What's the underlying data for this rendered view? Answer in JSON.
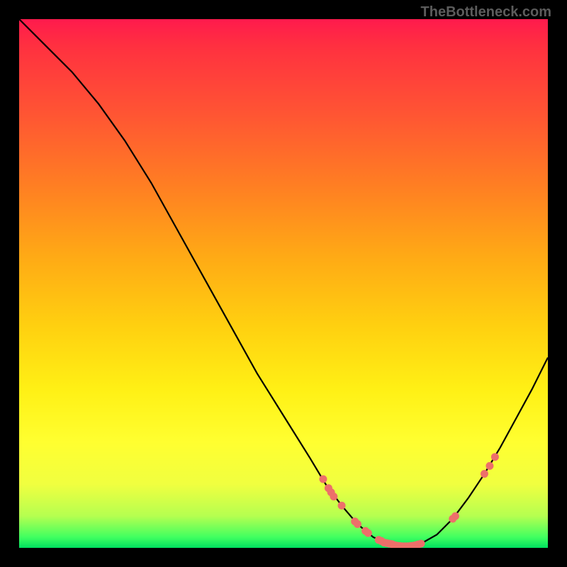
{
  "attribution": "TheBottleneck.com",
  "chart_data": {
    "type": "line",
    "title": "",
    "xlabel": "",
    "ylabel": "",
    "xlim": [
      0,
      100
    ],
    "ylim": [
      0,
      100
    ],
    "curve": [
      {
        "x": 0.0,
        "y": 100.0
      },
      {
        "x": 5.0,
        "y": 95.0
      },
      {
        "x": 10.0,
        "y": 90.0
      },
      {
        "x": 15.0,
        "y": 84.0
      },
      {
        "x": 20.0,
        "y": 77.0
      },
      {
        "x": 25.0,
        "y": 69.0
      },
      {
        "x": 30.0,
        "y": 60.0
      },
      {
        "x": 35.0,
        "y": 51.0
      },
      {
        "x": 40.0,
        "y": 42.0
      },
      {
        "x": 45.0,
        "y": 33.0
      },
      {
        "x": 50.0,
        "y": 25.0
      },
      {
        "x": 55.0,
        "y": 17.0
      },
      {
        "x": 58.0,
        "y": 12.0
      },
      {
        "x": 61.0,
        "y": 8.0
      },
      {
        "x": 64.0,
        "y": 4.5
      },
      {
        "x": 67.0,
        "y": 2.0
      },
      {
        "x": 70.0,
        "y": 0.8
      },
      {
        "x": 73.0,
        "y": 0.3
      },
      {
        "x": 76.0,
        "y": 0.8
      },
      {
        "x": 79.0,
        "y": 2.5
      },
      {
        "x": 82.0,
        "y": 5.5
      },
      {
        "x": 85.0,
        "y": 9.5
      },
      {
        "x": 88.0,
        "y": 14.0
      },
      {
        "x": 91.0,
        "y": 19.0
      },
      {
        "x": 94.0,
        "y": 24.5
      },
      {
        "x": 97.0,
        "y": 30.0
      },
      {
        "x": 100.0,
        "y": 36.0
      }
    ],
    "markers": [
      {
        "x": 57.5,
        "y": 13.0
      },
      {
        "x": 58.5,
        "y": 11.3
      },
      {
        "x": 59.0,
        "y": 10.5
      },
      {
        "x": 59.5,
        "y": 9.7
      },
      {
        "x": 61.0,
        "y": 8.0
      },
      {
        "x": 63.5,
        "y": 5.0
      },
      {
        "x": 64.0,
        "y": 4.5
      },
      {
        "x": 65.5,
        "y": 3.2
      },
      {
        "x": 66.0,
        "y": 2.8
      },
      {
        "x": 68.0,
        "y": 1.5
      },
      {
        "x": 68.5,
        "y": 1.3
      },
      {
        "x": 69.0,
        "y": 1.0
      },
      {
        "x": 69.5,
        "y": 0.9
      },
      {
        "x": 70.0,
        "y": 0.8
      },
      {
        "x": 70.5,
        "y": 0.7
      },
      {
        "x": 71.0,
        "y": 0.5
      },
      {
        "x": 71.5,
        "y": 0.4
      },
      {
        "x": 72.0,
        "y": 0.35
      },
      {
        "x": 72.5,
        "y": 0.3
      },
      {
        "x": 73.0,
        "y": 0.3
      },
      {
        "x": 73.5,
        "y": 0.3
      },
      {
        "x": 74.0,
        "y": 0.35
      },
      {
        "x": 74.5,
        "y": 0.4
      },
      {
        "x": 75.0,
        "y": 0.5
      },
      {
        "x": 75.5,
        "y": 0.65
      },
      {
        "x": 76.0,
        "y": 0.8
      },
      {
        "x": 82.0,
        "y": 5.5
      },
      {
        "x": 82.5,
        "y": 6.0
      },
      {
        "x": 88.0,
        "y": 14.0
      },
      {
        "x": 89.0,
        "y": 15.5
      },
      {
        "x": 90.0,
        "y": 17.2
      }
    ],
    "marker_color": "#ed6f6a",
    "marker_radius_px": 5.5
  }
}
